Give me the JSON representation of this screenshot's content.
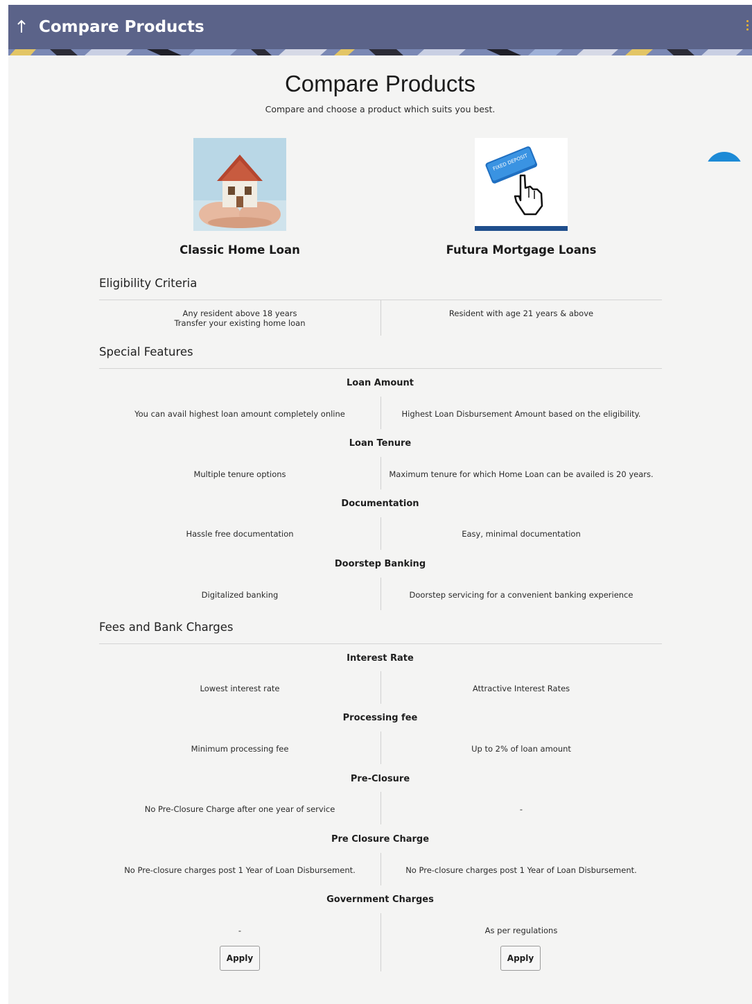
{
  "header": {
    "back_icon": "arrow-up-icon",
    "title": "Compare Products",
    "menu_icon": "vertical-dots-icon",
    "colors": {
      "bar": "#5b6389",
      "text": "#ffffff",
      "dots": "#f2b530"
    }
  },
  "main": {
    "title": "Compare Products",
    "subtitle": "Compare and choose a product which suits you best."
  },
  "products": [
    {
      "name": "Classic Home Loan",
      "image_icon": "house-in-hands-image",
      "apply_label": "Apply"
    },
    {
      "name": "Futura Mortgage Loans",
      "image_icon": "fixed-deposit-button-image",
      "image_text": "FIXED DEPOSIT",
      "apply_label": "Apply"
    }
  ],
  "sections": {
    "eligibility": {
      "title": "Eligibility Criteria",
      "left_lines": [
        "Any resident above 18 years",
        "Transfer your existing home loan"
      ],
      "right_lines": [
        "Resident with age 21 years & above"
      ]
    },
    "special_features": {
      "title": "Special Features",
      "rows": [
        {
          "name": "Loan Amount",
          "left": "You can avail highest loan amount completely online",
          "right": "Highest Loan Disbursement Amount based on the eligibility."
        },
        {
          "name": "Loan Tenure",
          "left": "Multiple tenure options",
          "right": "Maximum tenure for which Home Loan can be availed is 20 years."
        },
        {
          "name": "Documentation",
          "left": "Hassle free documentation",
          "right": "Easy, minimal documentation"
        },
        {
          "name": "Doorstep Banking",
          "left": "Digitalized banking",
          "right": "Doorstep servicing for a convenient banking experience"
        }
      ]
    },
    "fees": {
      "title": "Fees and Bank Charges",
      "rows": [
        {
          "name": "Interest Rate",
          "left": "Lowest interest rate",
          "right": "Attractive Interest Rates"
        },
        {
          "name": "Processing fee",
          "left": "Minimum processing fee",
          "right": "Up to 2% of loan amount"
        },
        {
          "name": "Pre-Closure",
          "left": "No Pre-Closure Charge after one year of service",
          "right": "-"
        },
        {
          "name": "Pre Closure Charge",
          "left": "No Pre-closure charges post 1 Year of Loan Disbursement.",
          "right": "No Pre-closure charges post 1 Year of Loan Disbursement."
        },
        {
          "name": "Government Charges",
          "left": "-",
          "right": "As per regulations"
        }
      ]
    }
  },
  "accent_color": "#1d8ad6"
}
